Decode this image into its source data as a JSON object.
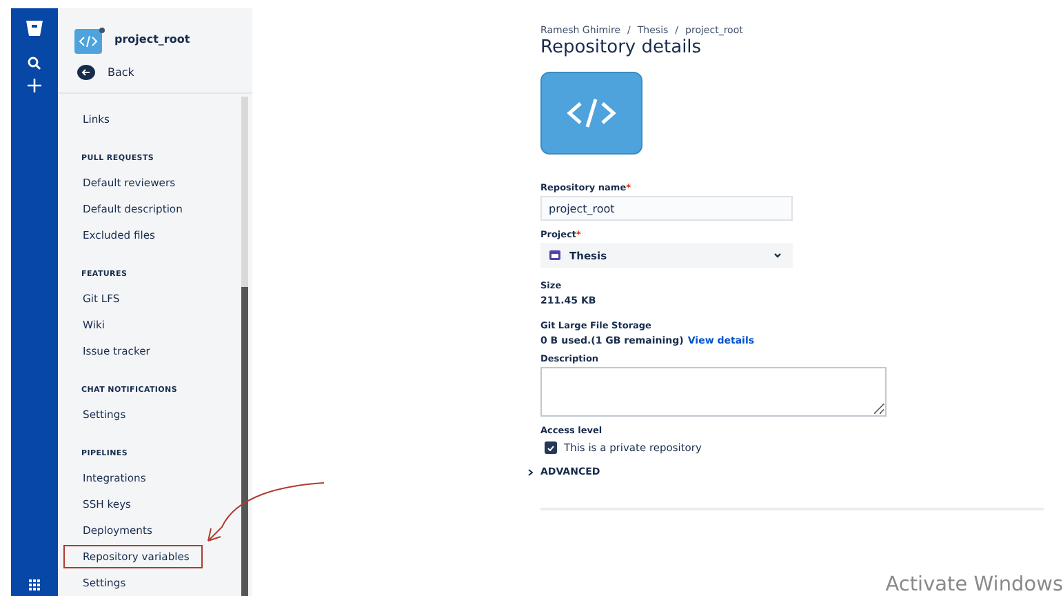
{
  "sidebar": {
    "repo_name": "project_root",
    "back_label": "Back",
    "sections": [
      {
        "items": [
          {
            "label": "Links",
            "annotated": false
          }
        ]
      },
      {
        "heading": "PULL REQUESTS",
        "items": [
          {
            "label": "Default reviewers",
            "annotated": false
          },
          {
            "label": "Default description",
            "annotated": false
          },
          {
            "label": "Excluded files",
            "annotated": false
          }
        ]
      },
      {
        "heading": "FEATURES",
        "items": [
          {
            "label": "Git LFS",
            "annotated": false
          },
          {
            "label": "Wiki",
            "annotated": false
          },
          {
            "label": "Issue tracker",
            "annotated": false
          }
        ]
      },
      {
        "heading": "CHAT NOTIFICATIONS",
        "items": [
          {
            "label": "Settings",
            "annotated": false
          }
        ]
      },
      {
        "heading": "PIPELINES",
        "items": [
          {
            "label": "Integrations",
            "annotated": false
          },
          {
            "label": "SSH keys",
            "annotated": false
          },
          {
            "label": "Deployments",
            "annotated": false
          },
          {
            "label": "Repository variables",
            "annotated": true
          },
          {
            "label": "Settings",
            "annotated": false
          }
        ]
      }
    ]
  },
  "main": {
    "breadcrumbs": [
      "Ramesh Ghimire",
      "Thesis",
      "project_root"
    ],
    "breadcrumb_separator": "/",
    "title": "Repository details",
    "repository_name": {
      "label": "Repository name",
      "required_mark": "*",
      "value": "project_root"
    },
    "project": {
      "label": "Project",
      "required_mark": "*",
      "value": "Thesis"
    },
    "size": {
      "label": "Size",
      "value": "211.45 KB"
    },
    "lfs": {
      "label": "Git Large File Storage",
      "usage": "0 B used.(1 GB remaining)",
      "link": "View details"
    },
    "description": {
      "label": "Description"
    },
    "access": {
      "label": "Access level",
      "checkbox_label": "This is a private repository",
      "checked": true
    },
    "advanced": {
      "label": "ADVANCED",
      "expanded": false
    }
  },
  "os_overlay": {
    "text": "Activate Windows"
  }
}
